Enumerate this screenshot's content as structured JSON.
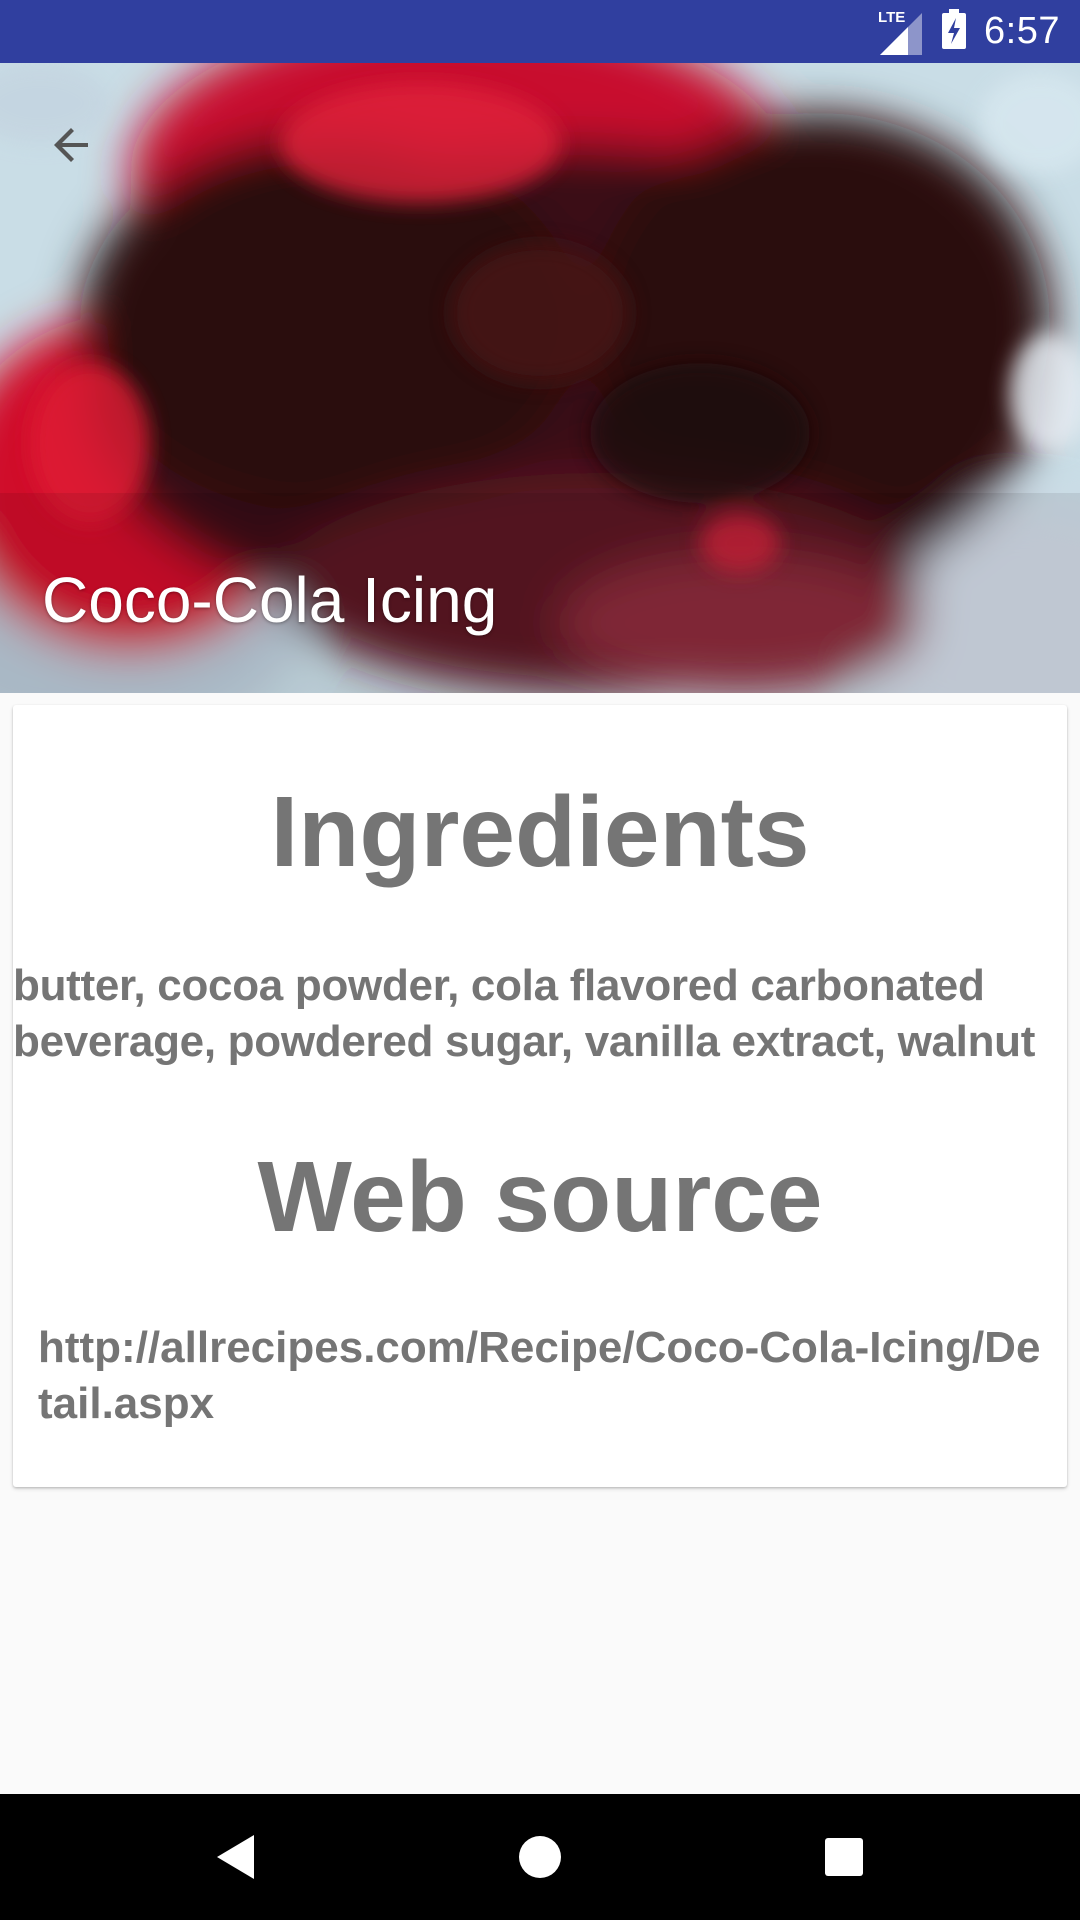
{
  "status_bar": {
    "time": "6:57",
    "network": "LTE",
    "bg_color": "#303f9f"
  },
  "header": {
    "title": "Coco-Cola Icing",
    "back_icon": "arrow-left-icon"
  },
  "ingredients": {
    "heading": "Ingredients",
    "text": "butter, cocoa powder, cola flavored carbonated beverage, powdered sugar, vanilla extract, walnut"
  },
  "web_source": {
    "heading": "Web source",
    "url": "http://allrecipes.com/Recipe/Coco-Cola-Icing/Detail.aspx"
  },
  "nav_bar": {
    "back_icon": "triangle-back-icon",
    "home_icon": "circle-home-icon",
    "recents_icon": "square-recents-icon"
  },
  "colors": {
    "text_gray": "#757575",
    "page_bg": "#fafafa",
    "card_bg": "#ffffff"
  }
}
